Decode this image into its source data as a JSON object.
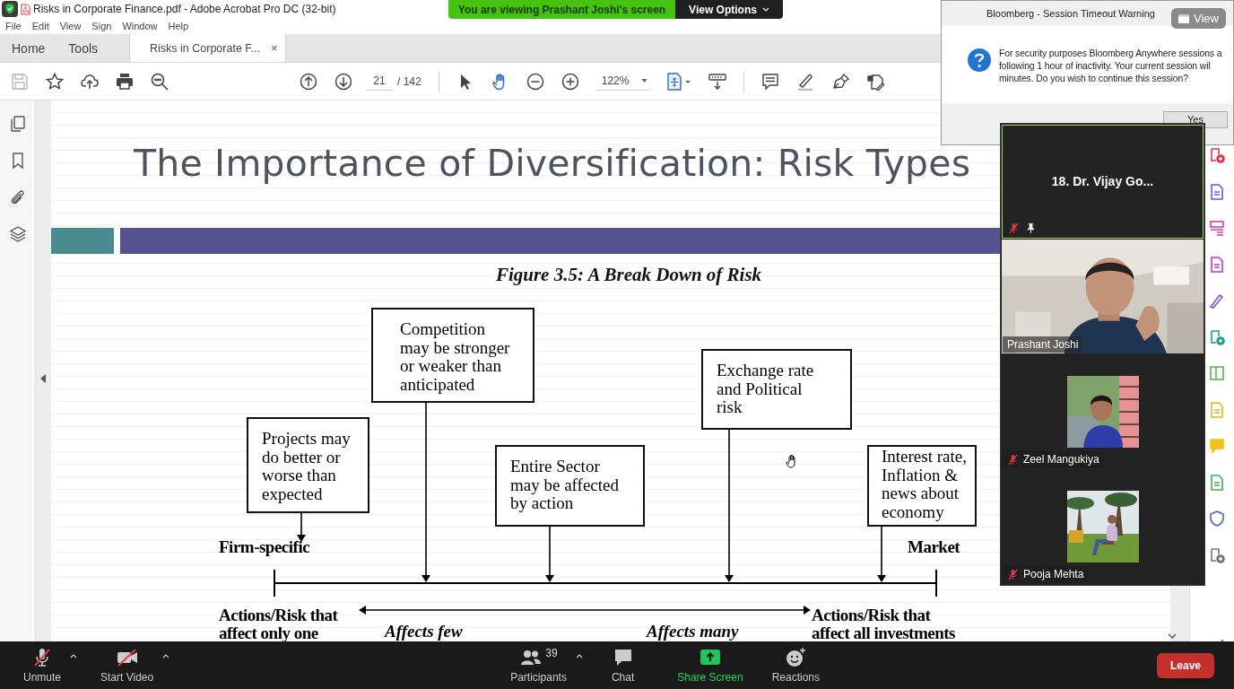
{
  "window": {
    "title": "Risks in Corporate Finance.pdf - Adobe Acrobat Pro DC (32-bit)"
  },
  "menu": [
    "File",
    "Edit",
    "View",
    "Sign",
    "Window",
    "Help"
  ],
  "tabs": [
    {
      "label": "Home",
      "selected": false
    },
    {
      "label": "Tools",
      "selected": false
    },
    {
      "label": "Risks in Corporate F...",
      "selected": true,
      "close": "×"
    }
  ],
  "toolbar": {
    "save_disabled": true,
    "page": "21",
    "page_total": "/ 142",
    "zoom": "122%",
    "tools": [
      {
        "kind": "select",
        "selected": false
      },
      {
        "kind": "hand",
        "selected": true
      }
    ]
  },
  "document": {
    "title": "The Importance of Diversification: Risk Types",
    "figure_caption": "Figure 3.5: A Break Down of Risk",
    "boxes": [
      "Competition may be stronger or weaker than anticipated",
      "Projects may do better or worse than expected",
      "Entire Sector may be affected by action",
      "Exchange rate and Political risk",
      "Interest rate, Inflation & news about economy"
    ],
    "scale_labels": [
      "Firm-specific",
      "Market"
    ],
    "bottom_labels": [
      "Actions/Risk that affect only one",
      "Affects few",
      "Affects many",
      "Actions/Risk that affect all investments"
    ]
  },
  "share_banner": {
    "text": "You are viewing Prashant Joshi's screen",
    "button": "View Options"
  },
  "dialog": {
    "title": "Bloomberg - Session Timeout Warning",
    "message_lines": [
      "For security purposes Bloomberg Anywhere sessions a",
      "following 1 hour of inactivity. Your current session wil",
      "minutes. Do you wish to continue this session?"
    ],
    "button": "Yes"
  },
  "view_pill": "View",
  "participants": [
    {
      "name": "18. Dr. Vijay Go...",
      "kind": "name",
      "muted": true,
      "pinned": true,
      "speaking": true
    },
    {
      "name": "Prashant Joshi",
      "kind": "video",
      "muted": false,
      "pinned": false,
      "speaking": false
    },
    {
      "name": "Zeel Mangukiya",
      "kind": "avatar",
      "muted": true,
      "pinned": false,
      "speaking": false
    },
    {
      "name": "Pooja Mehta",
      "kind": "avatar",
      "muted": true,
      "pinned": false,
      "speaking": false
    }
  ],
  "controls": [
    {
      "kind": "mic",
      "label": "Unmute",
      "off": true
    },
    {
      "kind": "video",
      "label": "Start Video",
      "off": true
    },
    {
      "kind": "participants",
      "label": "Participants",
      "count": "39"
    },
    {
      "kind": "chat",
      "label": "Chat"
    },
    {
      "kind": "share",
      "label": "Share Screen"
    },
    {
      "kind": "reactions",
      "label": "Reactions"
    }
  ],
  "leave": "Leave"
}
